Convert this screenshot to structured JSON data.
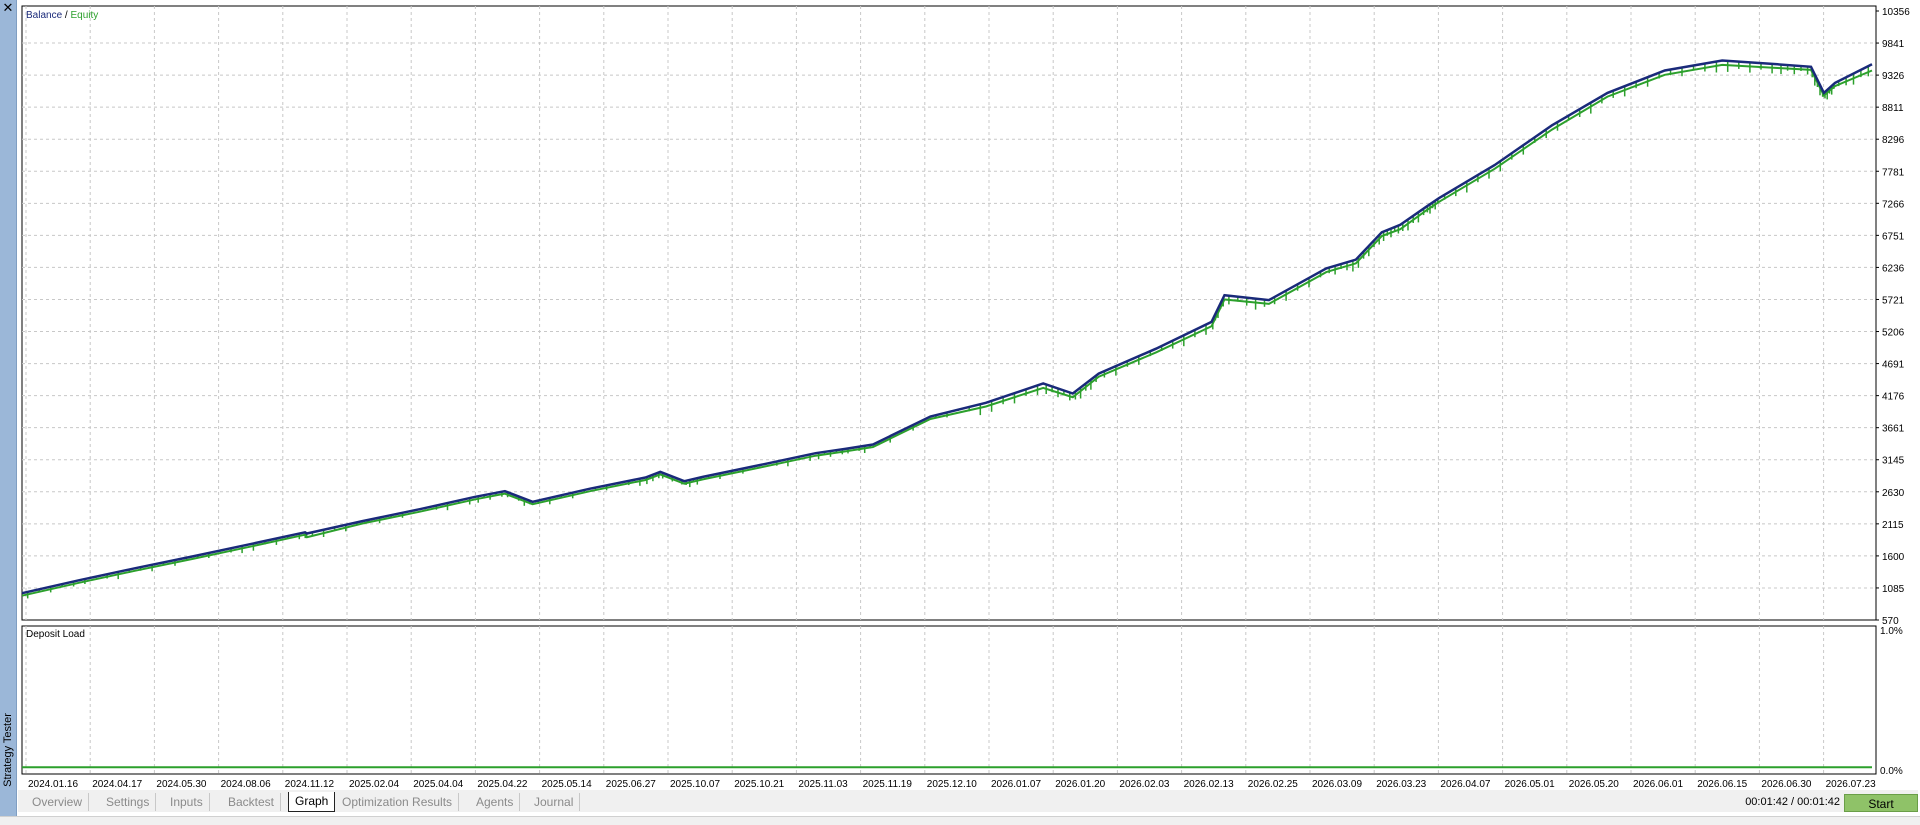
{
  "window": {
    "side_label": "Strategy Tester",
    "close_glyph": "✕"
  },
  "tabs": [
    {
      "label": "Overview",
      "active": false
    },
    {
      "label": "Settings",
      "active": false
    },
    {
      "label": "Inputs",
      "active": false
    },
    {
      "label": "Backtest",
      "active": false
    },
    {
      "label": "Graph",
      "active": true
    },
    {
      "label": "Optimization Results",
      "active": false
    },
    {
      "label": "Agents",
      "active": false
    },
    {
      "label": "Journal",
      "active": false
    }
  ],
  "status": {
    "time": "00:01:42 / 00:01:42",
    "start_label": "Start"
  },
  "colors": {
    "balance": "#1a2a7a",
    "equity": "#2ca02c",
    "grid": "#c8c8c8",
    "start_button": "#8fc268"
  },
  "chart_data": [
    {
      "type": "line",
      "legend": {
        "balance": "Balance",
        "separator": " / ",
        "equity": "Equity"
      },
      "legend_placement": "top-left",
      "grid": true,
      "ylim": [
        570,
        10356
      ],
      "y_ticks": [
        "10356",
        "9841",
        "9326",
        "8811",
        "8296",
        "7781",
        "7266",
        "6751",
        "6236",
        "5721",
        "5206",
        "4691",
        "4176",
        "3661",
        "3145",
        "2630",
        "2115",
        "1600",
        "1085",
        "570"
      ],
      "x_ticks": [
        "2024.01.16",
        "2024.04.17",
        "2024.05.30",
        "2024.08.06",
        "2024.11.12",
        "2025.02.04",
        "2025.04.04",
        "2025.04.22",
        "2025.05.14",
        "2025.06.27",
        "2025.10.07",
        "2025.10.21",
        "2025.11.03",
        "2025.11.19",
        "2025.12.10",
        "2026.01.07",
        "2026.01.20",
        "2026.02.03",
        "2026.02.13",
        "2026.02.25",
        "2026.03.09",
        "2026.03.23",
        "2026.04.07",
        "2026.05.01",
        "2026.05.20",
        "2026.06.01",
        "2026.06.15",
        "2026.06.30",
        "2026.07.23"
      ],
      "series": [
        {
          "name": "Balance",
          "x": [
            0,
            3.1,
            6.1,
            9.2,
            12.2,
            15.3,
            15.4,
            18.4,
            21.5,
            24.5,
            26.1,
            27.6,
            30.7,
            33.7,
            34.5,
            35.8,
            36.8,
            39.9,
            42.9,
            44.5,
            46.0,
            49.1,
            52.1,
            55.2,
            56.8,
            58.2,
            61.3,
            64.3,
            65.0,
            67.4,
            70.5,
            72.1,
            73.5,
            74.5,
            75.9,
            76.6,
            79.6,
            82.7,
            85.7,
            88.8,
            91.9,
            94.9,
            96.7,
            97.4,
            98.0,
            100
          ],
          "y": [
            1000,
            1210,
            1400,
            1590,
            1780,
            1980,
            1960,
            2160,
            2350,
            2550,
            2640,
            2470,
            2680,
            2860,
            2950,
            2800,
            2870,
            3060,
            3250,
            3320,
            3390,
            3840,
            4060,
            4370,
            4210,
            4530,
            4930,
            5360,
            5790,
            5710,
            6220,
            6360,
            6800,
            6920,
            7210,
            7350,
            7880,
            8520,
            9040,
            9400,
            9560,
            9500,
            9460,
            9040,
            9200,
            9500
          ]
        },
        {
          "name": "Equity",
          "x": [
            0,
            3.1,
            6.1,
            9.2,
            12.2,
            15.3,
            15.4,
            18.4,
            21.5,
            24.5,
            26.1,
            27.6,
            30.7,
            33.7,
            34.5,
            35.8,
            36.8,
            39.9,
            42.9,
            44.5,
            46.0,
            49.1,
            52.1,
            55.2,
            56.8,
            58.2,
            61.3,
            64.3,
            65.0,
            67.4,
            70.5,
            72.1,
            73.5,
            74.5,
            75.9,
            76.6,
            79.6,
            82.7,
            85.7,
            88.8,
            91.9,
            94.9,
            96.7,
            97.4,
            98.0,
            100
          ],
          "y": [
            960,
            1170,
            1360,
            1550,
            1740,
            1940,
            1900,
            2120,
            2310,
            2510,
            2600,
            2430,
            2640,
            2820,
            2910,
            2760,
            2830,
            3020,
            3210,
            3280,
            3350,
            3800,
            4000,
            4300,
            4150,
            4480,
            4870,
            5290,
            5720,
            5650,
            6160,
            6300,
            6740,
            6850,
            7150,
            7290,
            7820,
            8450,
            8980,
            9330,
            9490,
            9440,
            9410,
            9000,
            9150,
            9400
          ]
        }
      ]
    },
    {
      "type": "line",
      "title": "Deposit Load",
      "ylim": [
        0.0,
        1.0
      ],
      "y_ticks": [
        "1.0%",
        "0.0%"
      ],
      "series": [
        {
          "x": [
            0,
            50,
            100
          ],
          "y": [
            0.02,
            0.02,
            0.02
          ]
        }
      ]
    }
  ]
}
